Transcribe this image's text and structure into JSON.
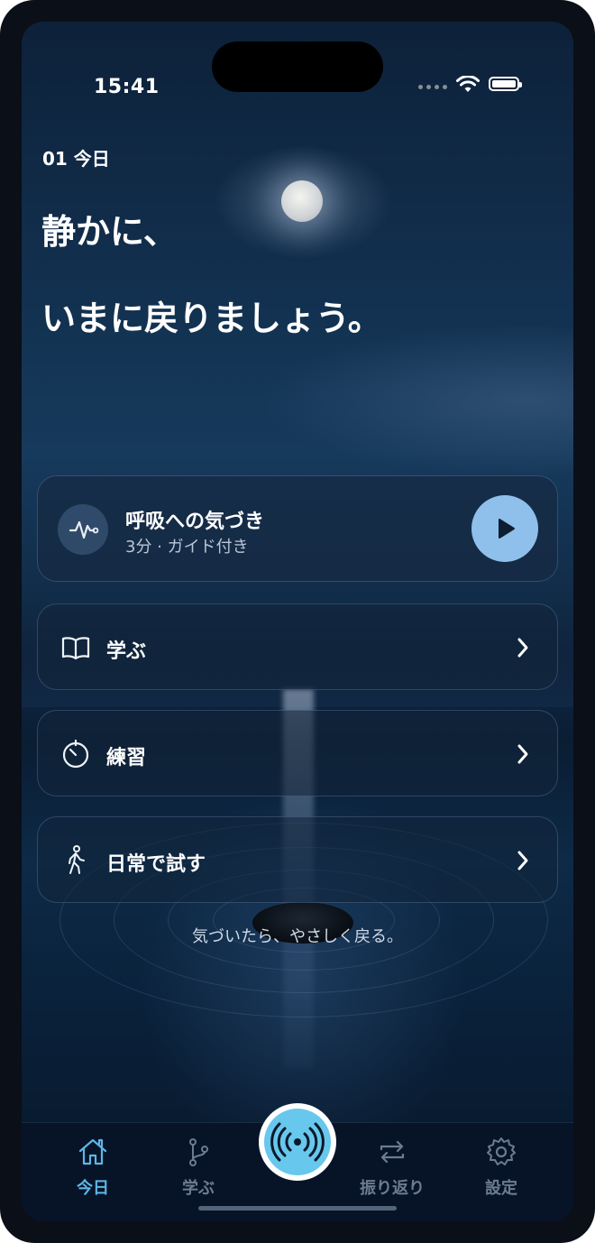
{
  "status_bar": {
    "time": "15:41"
  },
  "header": {
    "day_label": "01 今日",
    "headline_line1": "静かに、",
    "headline_line2": "いまに戻りましょう。"
  },
  "featured": {
    "title": "呼吸への気づき",
    "subtitle": "3分 · ガイド付き",
    "icon": "pulse-icon",
    "play_icon": "play-icon"
  },
  "menu": [
    {
      "label": "学ぶ",
      "icon": "book-icon"
    },
    {
      "label": "練習",
      "icon": "timer-icon"
    },
    {
      "label": "日常で試す",
      "icon": "walking-person-icon"
    }
  ],
  "quote": "気づいたら、やさしく戻る。",
  "tabbar": {
    "tabs": [
      {
        "label": "今日",
        "icon": "home-icon",
        "active": true
      },
      {
        "label": "学ぶ",
        "icon": "branch-icon",
        "active": false
      },
      {
        "label": "振り返り",
        "icon": "repeat-icon",
        "active": false
      },
      {
        "label": "設定",
        "icon": "gear-icon",
        "active": false
      }
    ],
    "center_icon": "broadcast-icon"
  },
  "colors": {
    "accent": "#68c7ec",
    "play_button": "#8fc0ec",
    "active_tab": "#5db6e6",
    "inactive_tab": "#6b7c91"
  }
}
